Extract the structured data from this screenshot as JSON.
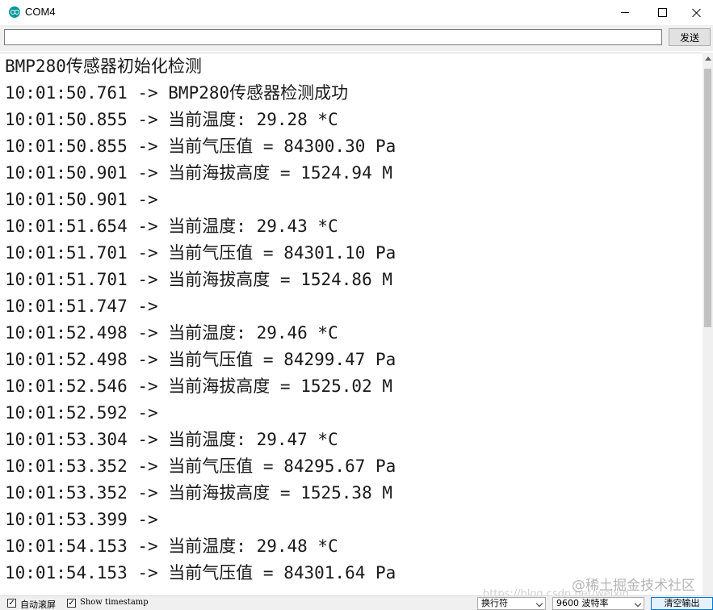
{
  "window": {
    "title": "COM4"
  },
  "send": {
    "input_value": "",
    "button_label": "发送"
  },
  "output_lines": [
    "BMP280传感器初始化检测",
    "10:01:50.761 -> BMP280传感器检测成功",
    "10:01:50.855 -> 当前温度: 29.28 *C",
    "10:01:50.855 -> 当前气压值 = 84300.30 Pa",
    "10:01:50.901 -> 当前海拔高度 = 1524.94 M",
    "10:01:50.901 -> ",
    "10:01:51.654 -> 当前温度: 29.43 *C",
    "10:01:51.701 -> 当前气压值 = 84301.10 Pa",
    "10:01:51.701 -> 当前海拔高度 = 1524.86 M",
    "10:01:51.747 -> ",
    "10:01:52.498 -> 当前温度: 29.46 *C",
    "10:01:52.498 -> 当前气压值 = 84299.47 Pa",
    "10:01:52.546 -> 当前海拔高度 = 1525.02 M",
    "10:01:52.592 -> ",
    "10:01:53.304 -> 当前温度: 29.47 *C",
    "10:01:53.352 -> 当前气压值 = 84295.67 Pa",
    "10:01:53.352 -> 当前海拔高度 = 1525.38 M",
    "10:01:53.399 -> ",
    "10:01:54.153 -> 当前温度: 29.48 *C",
    "10:01:54.153 -> 当前气压值 = 84301.64 Pa"
  ],
  "statusbar": {
    "autoscroll_label": "自动滚屏",
    "autoscroll_checked": true,
    "timestamp_label": "Show timestamp",
    "timestamp_checked": true,
    "line_ending": "换行符",
    "baud_rate": "9600 波特率",
    "clear_label": "清空输出"
  },
  "watermark": {
    "text": "@稀土掘金技术社区",
    "url": "https://blog.csdn.net/weixin_"
  }
}
